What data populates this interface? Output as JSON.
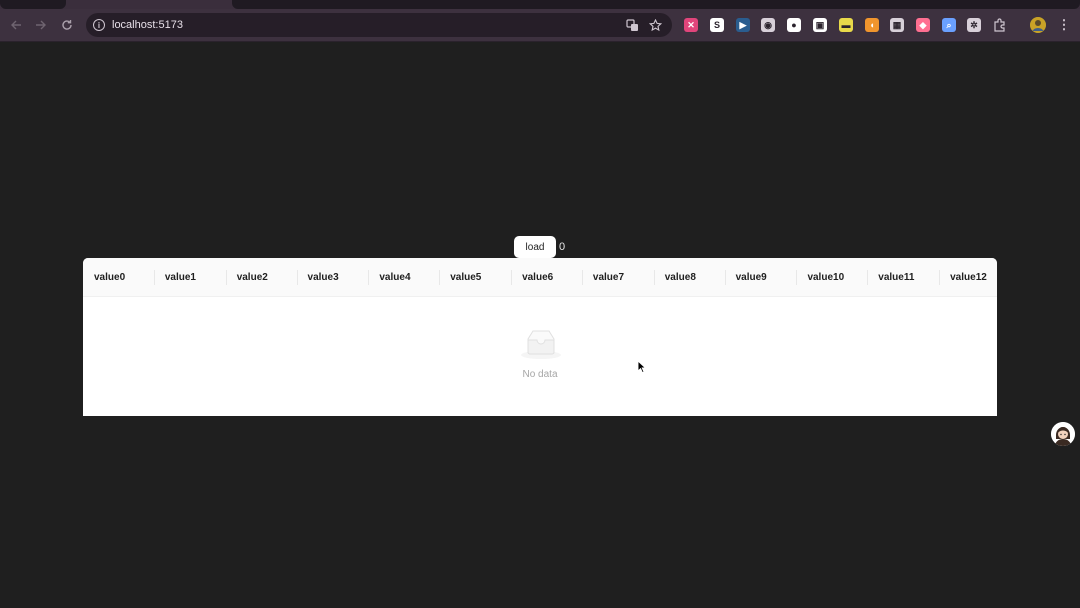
{
  "browser": {
    "url": "localhost:5173",
    "icons": {
      "back": "back-arrow-icon",
      "forward": "forward-arrow-icon",
      "reload": "reload-icon",
      "info": "site-info-icon",
      "translate": "translate-icon",
      "bookmark": "star-icon",
      "extensions": "puzzle-icon",
      "menu": "kebab-menu-icon"
    },
    "extensions": [
      {
        "name": "extension-pink",
        "color": "#e0457b",
        "glyph": "✕"
      },
      {
        "name": "extension-s",
        "color": "#ffffff",
        "glyph": "S"
      },
      {
        "name": "extension-camera",
        "color": "#2a5d8f",
        "glyph": "▶"
      },
      {
        "name": "extension-circle",
        "color": "#d8d0d9",
        "glyph": "◉"
      },
      {
        "name": "extension-bubble",
        "color": "#ffffff",
        "glyph": "●"
      },
      {
        "name": "extension-image",
        "color": "#ffffff",
        "glyph": "▣"
      },
      {
        "name": "extension-yellow",
        "color": "#e8d94a",
        "glyph": "▬"
      },
      {
        "name": "extension-orange",
        "color": "#f0952d",
        "glyph": "◖"
      },
      {
        "name": "extension-grid",
        "color": "#d8d0d9",
        "glyph": "▦"
      },
      {
        "name": "extension-gradient",
        "color": "#ff6f91",
        "glyph": "◆"
      },
      {
        "name": "extension-search",
        "color": "#6aa0ff",
        "glyph": "⌕"
      },
      {
        "name": "extension-react",
        "color": "#d8d0d9",
        "glyph": "✲"
      }
    ]
  },
  "page": {
    "load_button": "load",
    "counter": "0",
    "columns": [
      "value0",
      "value1",
      "value2",
      "value3",
      "value4",
      "value5",
      "value6",
      "value7",
      "value8",
      "value9",
      "value10",
      "value11",
      "value12"
    ],
    "empty_text": "No data"
  }
}
